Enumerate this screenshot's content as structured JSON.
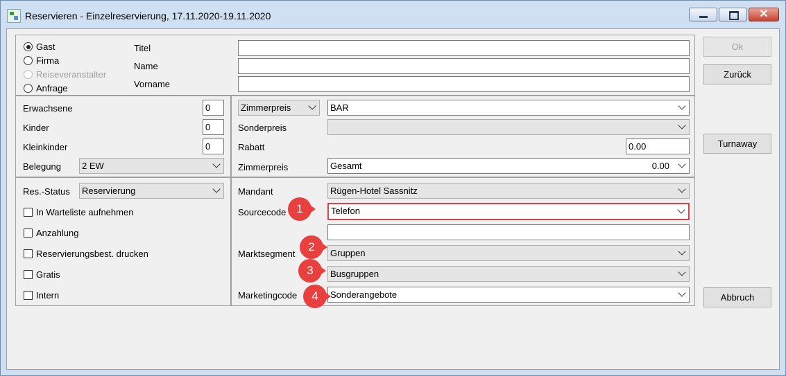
{
  "window": {
    "title": "Reservieren - Einzelreservierung, 17.11.2020-19.11.2020",
    "close_glyph": "✕"
  },
  "guest": {
    "types": [
      {
        "label": "Gast",
        "checked": true,
        "disabled": false
      },
      {
        "label": "Firma",
        "checked": false,
        "disabled": false
      },
      {
        "label": "Reiseveranstalter",
        "checked": false,
        "disabled": true
      },
      {
        "label": "Anfrage",
        "checked": false,
        "disabled": false
      }
    ],
    "fields": [
      {
        "label": "Titel",
        "value": ""
      },
      {
        "label": "Name",
        "value": ""
      },
      {
        "label": "Vorname",
        "value": ""
      }
    ]
  },
  "occupancy": {
    "adults_label": "Erwachsene",
    "adults_value": "0",
    "children_label": "Kinder",
    "children_value": "0",
    "infants_label": "Kleinkinder",
    "infants_value": "0",
    "belegung_label": "Belegung",
    "belegung_value": "2 EW"
  },
  "price": {
    "type_value": "Zimmerpreis",
    "rate_value": "BAR",
    "special_label": "Sonderpreis",
    "special_value": "",
    "discount_label": "Rabatt",
    "discount_value": "0.00",
    "room_price_label": "Zimmerpreis",
    "room_price_mode": "Gesamt",
    "room_price_value": "0.00"
  },
  "status": {
    "label": "Res.-Status",
    "value": "Reservierung",
    "options": [
      {
        "label": "In Warteliste aufnehmen",
        "checked": false
      },
      {
        "label": "Anzahlung",
        "checked": false
      },
      {
        "label": "Reservierungsbest. drucken",
        "checked": false
      },
      {
        "label": "Gratis",
        "checked": false
      },
      {
        "label": "Intern",
        "checked": false
      }
    ]
  },
  "booking": {
    "mandant_label": "Mandant",
    "mandant_value": "Rügen-Hotel Sassnitz",
    "sourcecode_label": "Sourcecode",
    "sourcecode_value": "Telefon",
    "extra_value": "",
    "marktsegment_label": "Marktsegment",
    "marktsegment_value": "Gruppen",
    "subsegment_value": "Busgruppen",
    "marketingcode_label": "Marketingcode",
    "marketingcode_value": "Sonderangebote"
  },
  "buttons": {
    "ok": "Ok",
    "back": "Zurück",
    "turnaway": "Turnaway",
    "cancel": "Abbruch"
  },
  "callouts": [
    "1",
    "2",
    "3",
    "4"
  ],
  "colors": {
    "callout": "#e8403f",
    "highlight_border": "#d9434a"
  }
}
